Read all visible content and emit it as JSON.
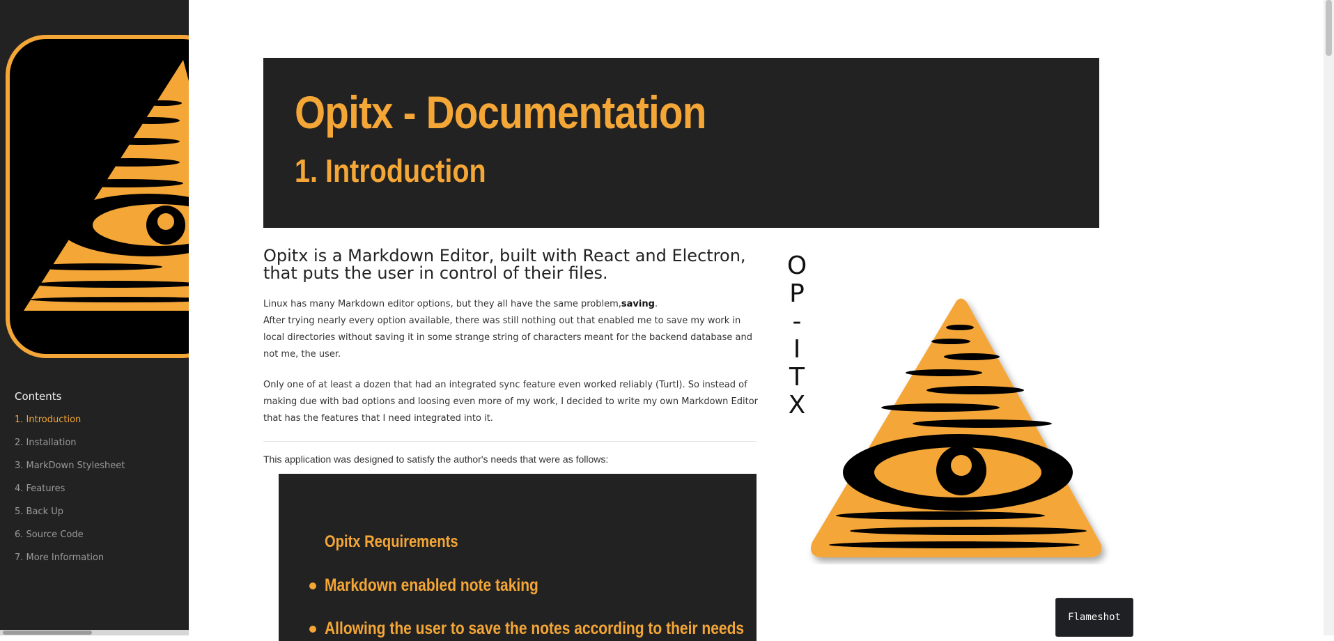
{
  "sidebar": {
    "contents_title": "Contents",
    "items": [
      {
        "label": "1. Introduction",
        "active": true
      },
      {
        "label": "2. Installation",
        "active": false
      },
      {
        "label": "3. MarkDown Stylesheet",
        "active": false
      },
      {
        "label": "4. Features",
        "active": false
      },
      {
        "label": "5. Back Up",
        "active": false
      },
      {
        "label": "6. Source Code",
        "active": false
      },
      {
        "label": "7. More Information",
        "active": false
      }
    ]
  },
  "header": {
    "title": "Opitx - Documentation",
    "subtitle": "1. Introduction"
  },
  "main": {
    "lead": "Opitx is a Markdown Editor, built with React and Electron, that puts the user in control of their files.",
    "para1_part1": "Linux has many Markdown editor options, but they all have the same problem,",
    "para1_bold": "saving",
    "para1_part2": ".",
    "para1_line2": "After trying nearly every option available, there was still nothing out that enabled me to save my work in local directories without saving it in some strange string of characters meant for the backend database and not me, the user.",
    "para2": "Only one of at least a dozen that had an integrated sync feature even worked reliably (Turtl). So instead of making due with bad options and loosing even more of my work, I decided to write my own Markdown Editor that has the features that I need integrated into it.",
    "needs_intro": "This application was designed to satisfy the author's needs that were as follows:",
    "requirements": {
      "title": "Opitx Requirements",
      "items": [
        "Markdown enabled note taking",
        "Allowing the user to save the notes according to their needs"
      ]
    },
    "vertical_letters": [
      "O",
      "P",
      "-",
      "I",
      "T",
      "X"
    ]
  },
  "overlay": {
    "flameshot_label": "Flameshot"
  },
  "colors": {
    "accent": "#f4a637",
    "panel": "#222222"
  }
}
